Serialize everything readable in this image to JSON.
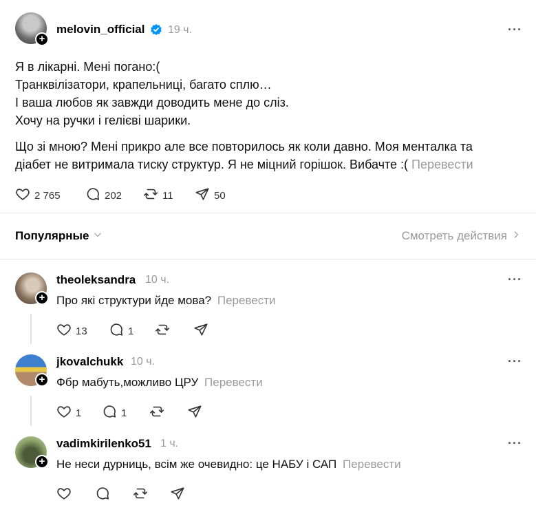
{
  "post": {
    "username": "melovin_official",
    "time": "19 ч.",
    "lines": [
      "Я в лікарні. Мені погано:(",
      "Транквілізатори, крапельниці, багато сплю…",
      "І ваша любов як завжди доводить мене до сліз.",
      "Хочу на ручки і гелієві шарики."
    ],
    "para2_line1": "Що зі мною? Мені прикро але все повторилось як коли давно. Моя менталка та",
    "para2_line2": "діабет не витримала тиску структур. Я не міцний горішок. Вибачте :(",
    "translate": "Перевести",
    "likes": "2 765",
    "comments": "202",
    "reposts": "11",
    "shares": "50"
  },
  "filter": {
    "label": "Популярные",
    "view_actions": "Смотреть действия"
  },
  "replies": [
    {
      "username": "theoleksandra",
      "time": "10 ч.",
      "text": "Про які структури йде мова?",
      "translate": "Перевести",
      "likes": "13",
      "comments": "1"
    },
    {
      "username": "jkovalchukk",
      "time": "10 ч.",
      "text": "Фбр мабуть,можливо ЦРУ",
      "translate": "Перевести",
      "likes": "1",
      "comments": "1"
    },
    {
      "username": "vadimkirilenko51",
      "time": "1 ч.",
      "text": "Не неси дурниць, всім же очевидно: це НАБУ і САП",
      "translate": "Перевести",
      "likes": "",
      "comments": ""
    }
  ],
  "icons": {
    "verified": "verified-badge-icon",
    "like": "heart-icon",
    "comment": "comment-icon",
    "repost": "repost-icon",
    "share": "share-icon",
    "more": "more-icon",
    "chevron_down": "chevron-down-icon",
    "chevron_right": "chevron-right-icon"
  },
  "colors": {
    "verified": "#0095f6",
    "muted": "#999999"
  }
}
